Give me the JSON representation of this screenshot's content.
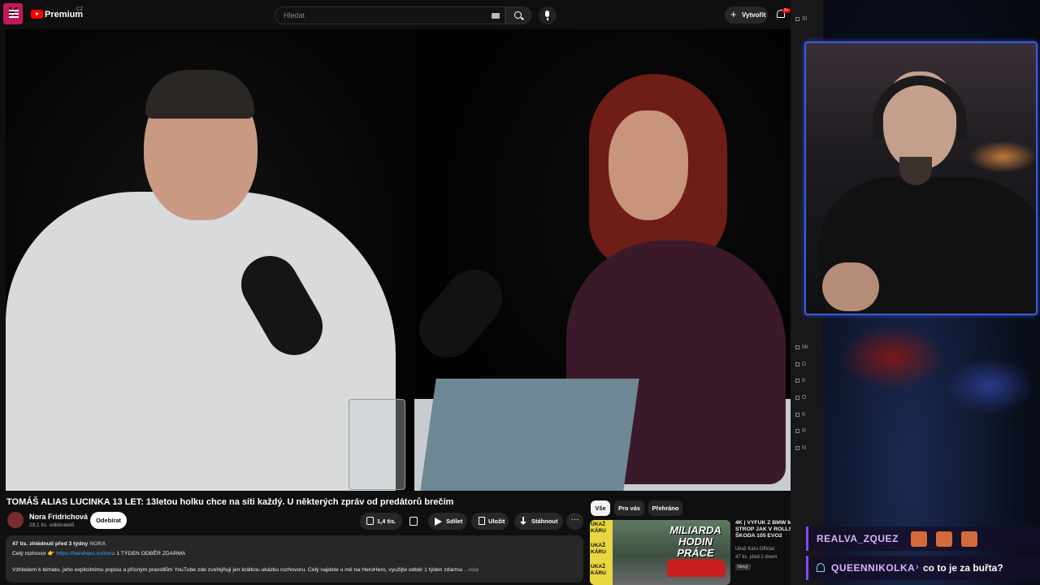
{
  "youtube": {
    "brand": "Premium",
    "brand_country": "CZ",
    "search_placeholder": "Hledat",
    "create_label": "Vytvořit",
    "notifications_badge": "9+",
    "video_title": "TOMÁŠ ALIAS LUCINKA 13 LET: 13letou holku chce na síti každý. U některých zpráv od predátorů brečím",
    "channel_name": "Nora Fridrichová",
    "channel_subs": "28,1 tis. odběratelů",
    "subscribe_label": "Odebírat",
    "likes": "1,4 tis.",
    "share_label": "Sdílet",
    "save_label": "Uložit",
    "download_label": "Stáhnout",
    "more_label": "···",
    "description": {
      "views_date": "47 tis. zhlédnutí  před 3 týdny",
      "tag": "NORA",
      "line2_pre": "Celý rozhovor 👉",
      "link": "https://herohero.co/nora",
      "line2_post": "1 TÝDEN ODBĚR ZDARMA",
      "line3": "Vzhledem k tématu, jeho explicitnímu popisu a přísným pravidlům YouTube zde zveřejňuji jen krátkou ukázku rozhovoru. Celý najdete u mě na HeroHero, využijte odběr 1 týden zdarma",
      "more": "...více"
    },
    "chips": [
      "Vše",
      "Pro vás",
      "Přehráno"
    ],
    "recommended": {
      "thumb_band": [
        "UKAŽ",
        "KÁRU",
        "UKAŽ",
        "KÁRU",
        "UKAŽ",
        "KÁRU"
      ],
      "thumb_title_1": "MILIARDA",
      "thumb_title_2": "HODIN PRÁCE",
      "title_lines": [
        "4K | VÝFUK Z BMW M",
        "STROP JAK V ROLLS",
        "ŠKODA 105 EVO2"
      ],
      "channel": "Ukaž Káru Official",
      "meta": "47 tis.  před 1 dnem",
      "badge": "Nový"
    }
  },
  "sidebar": {
    "items": [
      "Sl",
      "Mi",
      "D",
      "K",
      "O",
      "K",
      "R",
      "N"
    ]
  },
  "chat": [
    {
      "user": "REALVA_ZQUEZ",
      "message": ""
    },
    {
      "user": "QUEENNIKOLKA",
      "message": "co to je za buřta?"
    }
  ]
}
